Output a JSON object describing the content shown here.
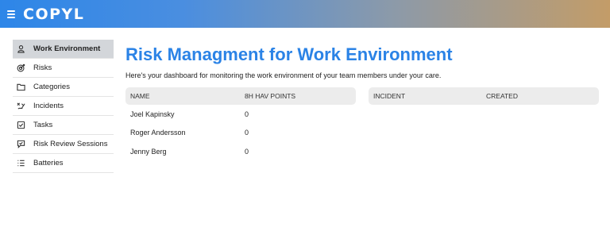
{
  "header": {
    "logo": "COPYL"
  },
  "sidebar": {
    "items": [
      {
        "label": "Work Environment",
        "icon": "person-badge-icon",
        "active": true
      },
      {
        "label": "Risks",
        "icon": "target-icon"
      },
      {
        "label": "Categories",
        "icon": "folder-icon"
      },
      {
        "label": "Incidents",
        "icon": "incident-icon"
      },
      {
        "label": "Tasks",
        "icon": "checkbox-icon"
      },
      {
        "label": "Risk Review Sessions",
        "icon": "chat-check-icon"
      },
      {
        "label": "Batteries",
        "icon": "list-icon"
      }
    ]
  },
  "main": {
    "title": "Risk Managment for Work Environment",
    "subtitle": "Here's your dashboard for monitoring the work environment of your team members under your care.",
    "members_table": {
      "headers": [
        "NAME",
        "8H HAV POINTS"
      ],
      "rows": [
        [
          "Joel Kapinsky",
          "0"
        ],
        [
          "Roger Andersson",
          "0"
        ],
        [
          "Jenny Berg",
          "0"
        ]
      ]
    },
    "incidents_table": {
      "headers": [
        "INCIDENT",
        "CREATED"
      ],
      "rows": []
    }
  },
  "colors": {
    "accent": "#2b83e6",
    "active_bg": "#d3d6da",
    "header_bg": "#ececec"
  }
}
